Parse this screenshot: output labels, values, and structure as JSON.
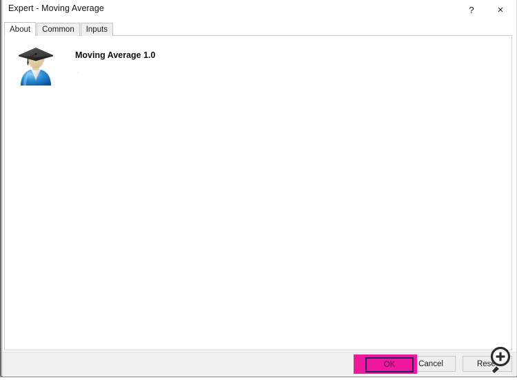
{
  "window": {
    "title": "Expert - Moving Average",
    "help_label": "?",
    "close_label": "×",
    "help_icon": "question-mark-icon",
    "close_icon": "close-icon"
  },
  "tabs": [
    {
      "label": "About",
      "selected": true
    },
    {
      "label": "Common",
      "selected": false
    },
    {
      "label": "Inputs",
      "selected": false
    }
  ],
  "about": {
    "icon_name": "graduation-cap-avatar-icon",
    "product_name": "Moving Average 1.0",
    "product_sub": "."
  },
  "footer": {
    "ok_label": "OK",
    "cancel_label": "Cancel",
    "reset_label": "Reset"
  },
  "cursor": {
    "icon_name": "zoom-in-magnifier-cursor",
    "symbol": "+"
  },
  "colors": {
    "highlight": "#f0179f",
    "focus_border": "#23235e",
    "window_bg": "#ffffff",
    "footer_bg": "#f0f0f0",
    "tab_inactive_bg": "#efefef"
  }
}
